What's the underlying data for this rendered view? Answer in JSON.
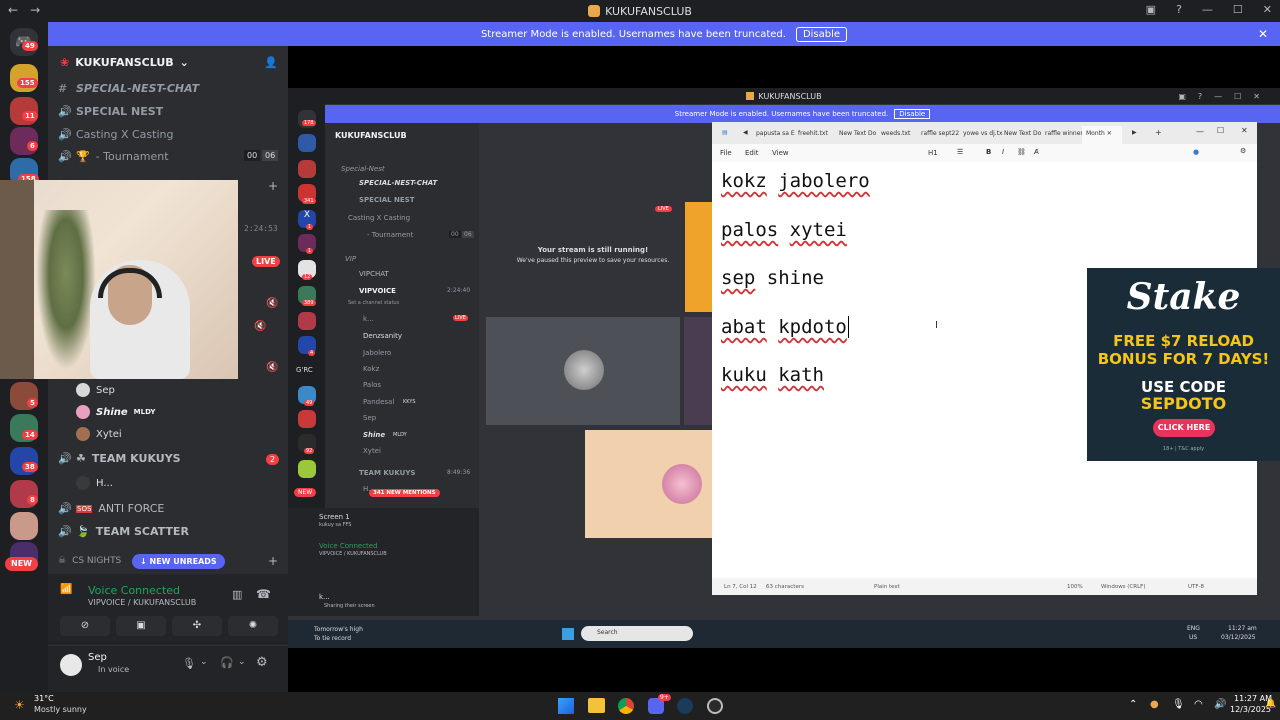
{
  "window": {
    "title": "KUKUFANSCLUB"
  },
  "banner": {
    "text": "Streamer Mode is enabled. Usernames have been truncated.",
    "disable": "Disable"
  },
  "servers": {
    "badges": [
      "49",
      "155",
      "11",
      "6",
      "158",
      "5",
      "14",
      "38",
      "8"
    ],
    "new_label": "NEW"
  },
  "guild": {
    "name": "KUKUFANSCLUB"
  },
  "channels": {
    "c1": "SPECIAL-NEST-CHAT",
    "c2": "SPECIAL NEST",
    "c3": "Casting X Casting",
    "c4": "- Tournament",
    "c4_n1": "00",
    "c4_n2": "06",
    "timer": "2:24:53",
    "live": "LIVE",
    "users": [
      "Sep",
      "Shine",
      "Xytei"
    ],
    "shine_tag": "MLDY",
    "team_kukuys": "TEAM KUKUYS",
    "team_badge": "2",
    "h_user": "H...",
    "anti_force": "ANTI FORCE",
    "team_scatter": "TEAM SCATTER",
    "cs_nights": "CS NIGHTS",
    "new_unreads": "NEW UNREADS"
  },
  "voice": {
    "status": "Voice Connected",
    "channel": "VIPVOICE / KUKUFANSCLUB"
  },
  "user": {
    "name": "Sep",
    "status": "In voice"
  },
  "inner": {
    "title": "KUKUFANSCLUB",
    "banner": "Streamer Mode is enabled. Usernames have been truncated.",
    "disable": "Disable",
    "guild": "KUKUFANSCLUB",
    "cat1": "Special-Nest",
    "ch1": "SPECIAL-NEST-CHAT",
    "ch2": "SPECIAL NEST",
    "ch3": "Casting X Casting",
    "ch4": "- Tournament",
    "ch4_n1": "00",
    "ch4_n2": "06",
    "cat2": "VIP",
    "vipchat": "VIPCHAT",
    "vipvoice": "VIPVOICE",
    "vip_timer": "2:24:40",
    "set_status": "Set a channel status",
    "members": [
      "k...",
      "Denzsanity",
      "Jabolero",
      "Kokz",
      "Palos",
      "Pandesal",
      "Sep",
      "Shine",
      "Xytei"
    ],
    "live": "LIVE",
    "pandesal_tag": "KKYS",
    "shine_tag": "MLDY",
    "team_kukuys": "TEAM KUKUYS",
    "team_timer": "8:49:36",
    "h_user": "H...",
    "mentions": "341 NEW MENTIONS",
    "screen": "Screen 1",
    "screen_sub": "kukuy sa FFS",
    "voice_status": "Voice Connected",
    "voice_channel": "VIPVOICE / KUKUFANSCLUB",
    "user": "k...",
    "user_status": "Sharing their screen",
    "stream_msg1": "Your stream is still running!",
    "stream_msg2": "We've paused this preview to save your resources.",
    "stream_live": "LIVE",
    "server_badges": [
      "178",
      "341",
      "1",
      "1",
      "12",
      "389",
      "1",
      "4",
      "49",
      "92"
    ],
    "new_label": "NEW",
    "grc": "G'RC"
  },
  "notepad": {
    "tabs": [
      "papusta sa E",
      "freehit.txt",
      "New Text Do",
      "weeds.txt",
      "raffle sept22",
      "yowe vs dj.tx",
      "New Text Do",
      "raffle winner",
      "Month"
    ],
    "menu": [
      "File",
      "Edit",
      "View"
    ],
    "heading": "H1",
    "lines": [
      [
        "kokz",
        "jabolero"
      ],
      [
        "palos",
        "xytei"
      ],
      [
        "sep",
        "shine"
      ],
      [
        "abat",
        "kpdoto"
      ],
      [
        "kuku",
        "kath"
      ]
    ],
    "status": {
      "pos": "Ln 7, Col 12",
      "chars": "63 characters",
      "format": "Plain text",
      "zoom": "100%",
      "eol": "Windows (CRLF)",
      "enc": "UTF-8"
    }
  },
  "stake": {
    "logo": "Stake",
    "line1": "FREE $7 RELOAD",
    "line2": "BONUS FOR 7 DAYS!",
    "use_code": "USE CODE",
    "code": "SEPDOTO",
    "cta": "CLICK HERE",
    "fine": "18+ | T&C apply"
  },
  "inner_taskbar": {
    "weather1": "Tomorrow's high",
    "weather2": "To tie record",
    "search": "Search",
    "lang1": "ENG",
    "lang2": "US",
    "time": "11:27 am",
    "date": "03/12/2025"
  },
  "taskbar": {
    "temp": "31°C",
    "weather": "Mostly sunny",
    "time": "11:27 AM",
    "date": "12/3/2025",
    "discord_badge": "9+"
  }
}
